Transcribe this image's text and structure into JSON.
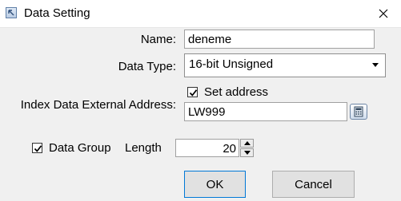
{
  "window": {
    "title": "Data Setting",
    "icon": "app-icon",
    "close_icon": "close-icon"
  },
  "form": {
    "name_label": "Name:",
    "name_value": "deneme",
    "data_type_label": "Data Type:",
    "data_type_value": "16-bit Unsigned",
    "set_address_label": "Set address",
    "set_address_checked": true,
    "index_label": "Index Data External Address:",
    "address_value": "LW999",
    "calculator_icon": "calculator-icon",
    "data_group_label": "Data Group",
    "data_group_checked": true,
    "length_label": "Length",
    "length_value": "20"
  },
  "buttons": {
    "ok": "OK",
    "cancel": "Cancel"
  },
  "colors": {
    "window_bg": "#f0f0f0",
    "default_button_border": "#0078d7"
  }
}
